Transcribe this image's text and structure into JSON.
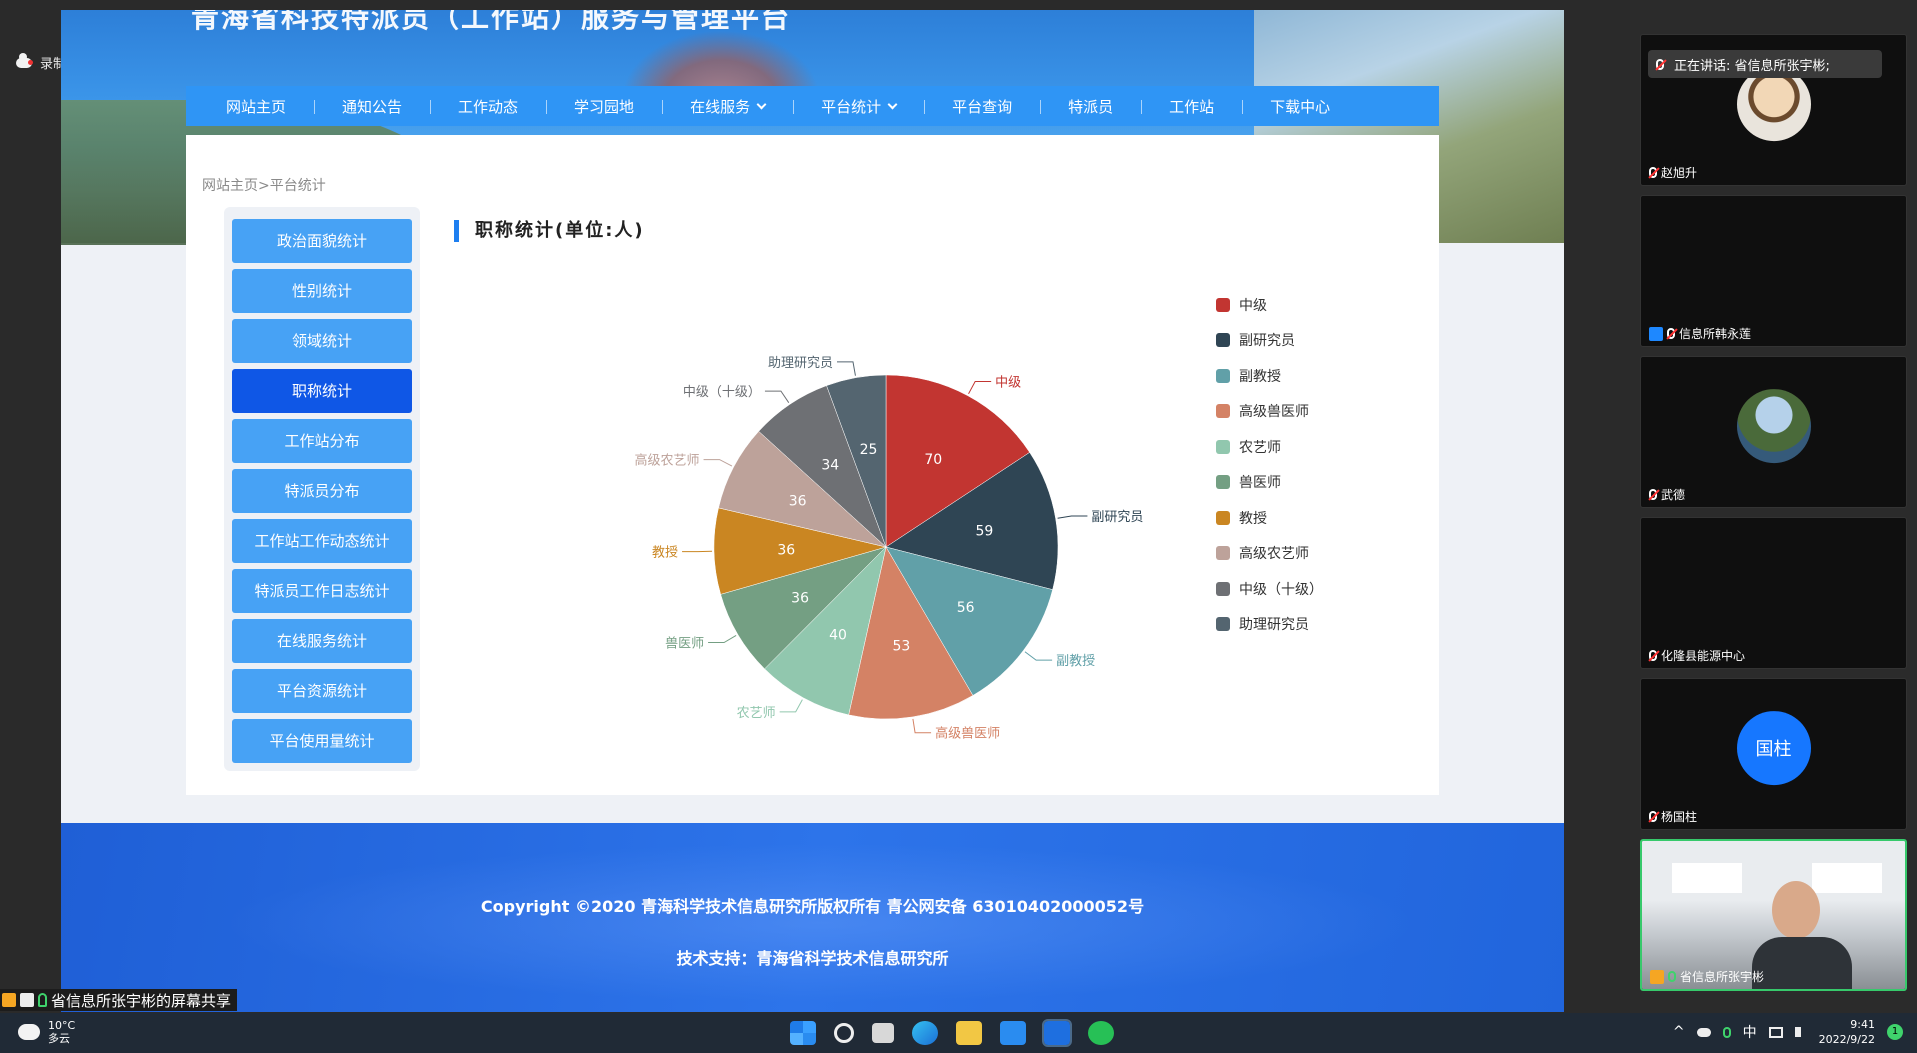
{
  "recording": {
    "label": "录制中"
  },
  "site": {
    "title": "青海省科技特派员（工作站）服务与管理平台",
    "nav": [
      {
        "label": "网站主页",
        "has_menu": false
      },
      {
        "label": "通知公告",
        "has_menu": false
      },
      {
        "label": "工作动态",
        "has_menu": false
      },
      {
        "label": "学习园地",
        "has_menu": false
      },
      {
        "label": "在线服务",
        "has_menu": true
      },
      {
        "label": "平台统计",
        "has_menu": true
      },
      {
        "label": "平台查询",
        "has_menu": false
      },
      {
        "label": "特派员",
        "has_menu": false
      },
      {
        "label": "工作站",
        "has_menu": false
      },
      {
        "label": "下载中心",
        "has_menu": false
      }
    ],
    "breadcrumb": "网站主页>平台统计",
    "sidebar": [
      {
        "label": "政治面貌统计"
      },
      {
        "label": "性别统计"
      },
      {
        "label": "领域统计"
      },
      {
        "label": "职称统计",
        "active": true
      },
      {
        "label": "工作站分布"
      },
      {
        "label": "特派员分布"
      },
      {
        "label": "工作站工作动态统计"
      },
      {
        "label": "特派员工作日志统计"
      },
      {
        "label": "在线服务统计"
      },
      {
        "label": "平台资源统计"
      },
      {
        "label": "平台使用量统计"
      }
    ],
    "footer": {
      "copyright": "Copyright ©2020 青海科学技术信息研究所版权所有 青公网安备 63010402000052号",
      "tech": "技术支持：青海省科学技术信息研究所"
    }
  },
  "chart_data": {
    "type": "pie",
    "title": "职称统计(单位:人)",
    "categories": [
      "中级",
      "副研究员",
      "副教授",
      "高级兽医师",
      "农艺师",
      "兽医师",
      "教授",
      "高级农艺师",
      "中级（十级）",
      "助理研究员"
    ],
    "values": [
      70,
      59,
      56,
      53,
      40,
      36,
      36,
      36,
      34,
      25
    ],
    "colors": [
      "#c23531",
      "#2f4554",
      "#61a0a8",
      "#d48265",
      "#91c7ae",
      "#749f83",
      "#ca8622",
      "#bda29a",
      "#6e7074",
      "#546570"
    ],
    "legend": "right"
  },
  "share": {
    "label": "省信息所张宇彬的屏幕共享"
  },
  "meeting": {
    "speaking": "正在讲话: 省信息所张宇彬;",
    "participants": [
      {
        "name": "赵旭升",
        "mic": "off",
        "avatar": "face"
      },
      {
        "name": "信息所韩永莲",
        "mic": "off",
        "avatar": "none"
      },
      {
        "name": "武德",
        "mic": "off",
        "avatar": "lake"
      },
      {
        "name": "化隆县能源中心",
        "mic": "off",
        "avatar": "none"
      },
      {
        "name": "杨国柱",
        "mic": "off",
        "avatar": "text",
        "avatar_text": "国柱"
      },
      {
        "name": "省信息所张宇彬",
        "mic": "on",
        "avatar": "video"
      }
    ]
  },
  "taskbar": {
    "temp": "10°C",
    "weather": "多云",
    "ime": "中",
    "time": "9:41",
    "date": "2022/9/22",
    "notifications": "1"
  }
}
